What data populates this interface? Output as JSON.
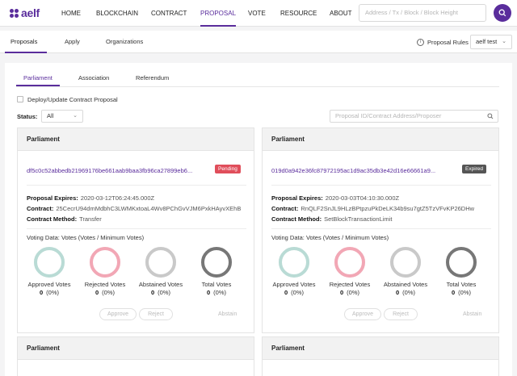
{
  "brand": {
    "logo_text": "aelf"
  },
  "nav": {
    "items": [
      "HOME",
      "BLOCKCHAIN",
      "CONTRACT",
      "PROPOSAL",
      "VOTE",
      "RESOURCE",
      "ABOUT"
    ],
    "active": "PROPOSAL",
    "search_placeholder": "Address / Tx / Block / Block Height"
  },
  "subnav": {
    "tabs": [
      "Proposals",
      "Apply",
      "Organizations"
    ],
    "active": "Proposals",
    "rules_label": "Proposal Rules",
    "network": "aelf test"
  },
  "org_tabs": {
    "items": [
      "Parliament",
      "Association",
      "Referendum"
    ],
    "active": "Parliament"
  },
  "filters": {
    "checkbox_label": "Deploy/Update Contract Proposal",
    "status_label": "Status:",
    "status_value": "All",
    "search_placeholder": "Proposal ID/Contract Address/Proposer"
  },
  "cards": [
    {
      "header": "Parliament",
      "id": "df5c0c52abbedb21969176be661aab9baa3fb96ca27899eb6...",
      "status": "Pending",
      "status_color": "#e04e5b",
      "expires_label": "Proposal Expires:",
      "expires": "2020-03-12T06:24:45.000Z",
      "contract_label": "Contract:",
      "contract": "25CecrU94dmMdbhC3LWMKxtoaL4Wv8PChGvVJM6PxkHAyvXEhB",
      "method_label": "Contract Method:",
      "method": "Transfer",
      "voting_title": "Voting Data: Votes (Votes / Minimum Votes)",
      "votes": [
        {
          "label": "Approved Votes",
          "count": "0",
          "pct": "(0%)",
          "color": "#b9dbd5"
        },
        {
          "label": "Rejected Votes",
          "count": "0",
          "pct": "(0%)",
          "color": "#f2a7b5"
        },
        {
          "label": "Abstained Votes",
          "count": "0",
          "pct": "(0%)",
          "color": "#c9c9c9"
        },
        {
          "label": "Total Votes",
          "count": "0",
          "pct": "(0%)",
          "color": "#777777"
        }
      ],
      "approve": "Approve",
      "reject": "Reject",
      "abstain": "Abstain"
    },
    {
      "header": "Parliament",
      "id": "019d0a942e36fc87972195ac1d9ac35db3e42d16e66661a9...",
      "status": "Expired",
      "status_color": "#555555",
      "expires_label": "Proposal Expires:",
      "expires": "2020-03-03T04:10:30.000Z",
      "contract_label": "Contract:",
      "contract": "RnQLF2SnJL9HLzBPtpzuPkDeLK34b9su7gtZ5TzVFvKP26DHw",
      "method_label": "Contract Method:",
      "method": "SetBlockTransactionLimit",
      "voting_title": "Voting Data: Votes (Votes / Minimum Votes)",
      "votes": [
        {
          "label": "Approved Votes",
          "count": "0",
          "pct": "(0%)",
          "color": "#b9dbd5"
        },
        {
          "label": "Rejected Votes",
          "count": "0",
          "pct": "(0%)",
          "color": "#f2a7b5"
        },
        {
          "label": "Abstained Votes",
          "count": "0",
          "pct": "(0%)",
          "color": "#c9c9c9"
        },
        {
          "label": "Total Votes",
          "count": "0",
          "pct": "(0%)",
          "color": "#777777"
        }
      ],
      "approve": "Approve",
      "reject": "Reject",
      "abstain": "Abstain"
    }
  ],
  "lower_cards": [
    {
      "header": "Parliament"
    },
    {
      "header": "Parliament"
    }
  ]
}
